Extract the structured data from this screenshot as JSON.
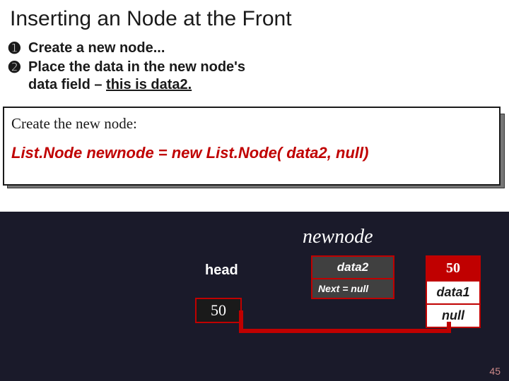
{
  "title": "Inserting an Node at the Front",
  "bullets": [
    {
      "marker": "➊",
      "text": "Create a new node..."
    },
    {
      "marker": "➋",
      "text": "Place the data in the new node's data field – this is data2.",
      "underline_tail": "this is data2."
    }
  ],
  "codebox": {
    "label": "Create the new node:",
    "code": "List.Node  newnode = new  List.Node( data2, null)"
  },
  "diagram": {
    "newnode_label": "newnode",
    "head_label": "head",
    "head_value": "50",
    "newbox": {
      "top": "data2",
      "bottom": "Next = null"
    },
    "rightbox": {
      "val": "50",
      "data": "data1",
      "next": "null"
    }
  },
  "page_number": "45"
}
